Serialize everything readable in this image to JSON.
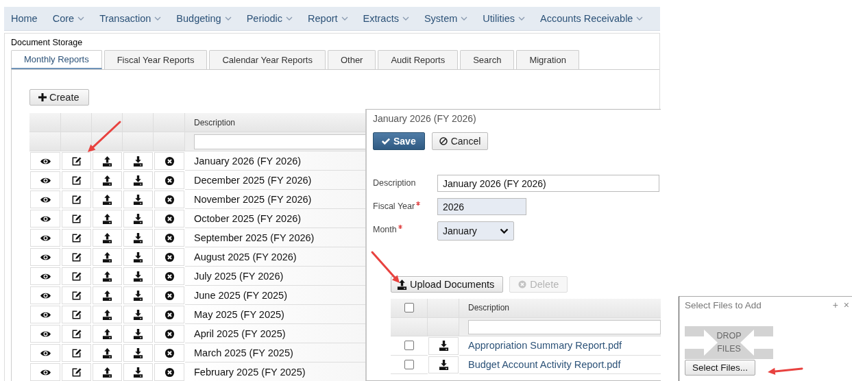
{
  "menu": [
    {
      "label": "Home",
      "has_dropdown": false
    },
    {
      "label": "Core",
      "has_dropdown": true
    },
    {
      "label": "Transaction",
      "has_dropdown": true
    },
    {
      "label": "Budgeting",
      "has_dropdown": true
    },
    {
      "label": "Periodic",
      "has_dropdown": true
    },
    {
      "label": "Report",
      "has_dropdown": true
    },
    {
      "label": "Extracts",
      "has_dropdown": true
    },
    {
      "label": "System",
      "has_dropdown": true
    },
    {
      "label": "Utilities",
      "has_dropdown": true
    },
    {
      "label": "Accounts Receivable",
      "has_dropdown": true
    }
  ],
  "page_title": "Document Storage",
  "tabs": [
    {
      "label": "Monthly Reports",
      "selected": true
    },
    {
      "label": "Fiscal Year Reports",
      "selected": false
    },
    {
      "label": "Calendar Year Reports",
      "selected": false
    },
    {
      "label": "Other",
      "selected": false
    },
    {
      "label": "Audit Reports",
      "selected": false
    },
    {
      "label": "Search",
      "selected": false
    },
    {
      "label": "Migration",
      "selected": false
    }
  ],
  "create_button": "Create",
  "grid": {
    "description_header": "Description",
    "rows": [
      {
        "description": "January 2026 (FY 2026)"
      },
      {
        "description": "December 2025 (FY 2026)"
      },
      {
        "description": "November 2025 (FY 2026)"
      },
      {
        "description": "October 2025 (FY 2026)"
      },
      {
        "description": "September 2025 (FY 2026)"
      },
      {
        "description": "August 2025 (FY 2026)"
      },
      {
        "description": "July 2025 (FY 2026)"
      },
      {
        "description": "June 2025 (FY 2025)"
      },
      {
        "description": "May 2025 (FY 2025)"
      },
      {
        "description": "April 2025 (FY 2025)"
      },
      {
        "description": "March 2025 (FY 2025)"
      },
      {
        "description": "February 2025 (FY 2025)"
      }
    ]
  },
  "edit_dialog": {
    "title": "January 2026 (FY 2026)",
    "save_button": "Save",
    "cancel_button": "Cancel",
    "fields": [
      {
        "label": "Description",
        "required": false,
        "kind": "text",
        "value": "January 2026 (FY 2026)"
      },
      {
        "label": "Fiscal Year",
        "required": true,
        "kind": "readonly",
        "value": "2026"
      },
      {
        "label": "Month",
        "required": true,
        "kind": "select",
        "value": "January"
      }
    ],
    "upload_button": "Upload Documents",
    "delete_button": {
      "label": "Delete",
      "disabled": true
    },
    "documents": {
      "header_checked": false,
      "description_header": "Description",
      "rows": [
        {
          "name": "Appropriation Summary Report.pdf",
          "checked": false
        },
        {
          "name": "Budget Account Activity Report.pdf",
          "checked": false
        }
      ]
    }
  },
  "file_picker": {
    "title": "Select Files to Add",
    "add_glyph": "+",
    "close_glyph": "×",
    "drop_label": "DROP FILES",
    "select_button": "Select Files..."
  }
}
